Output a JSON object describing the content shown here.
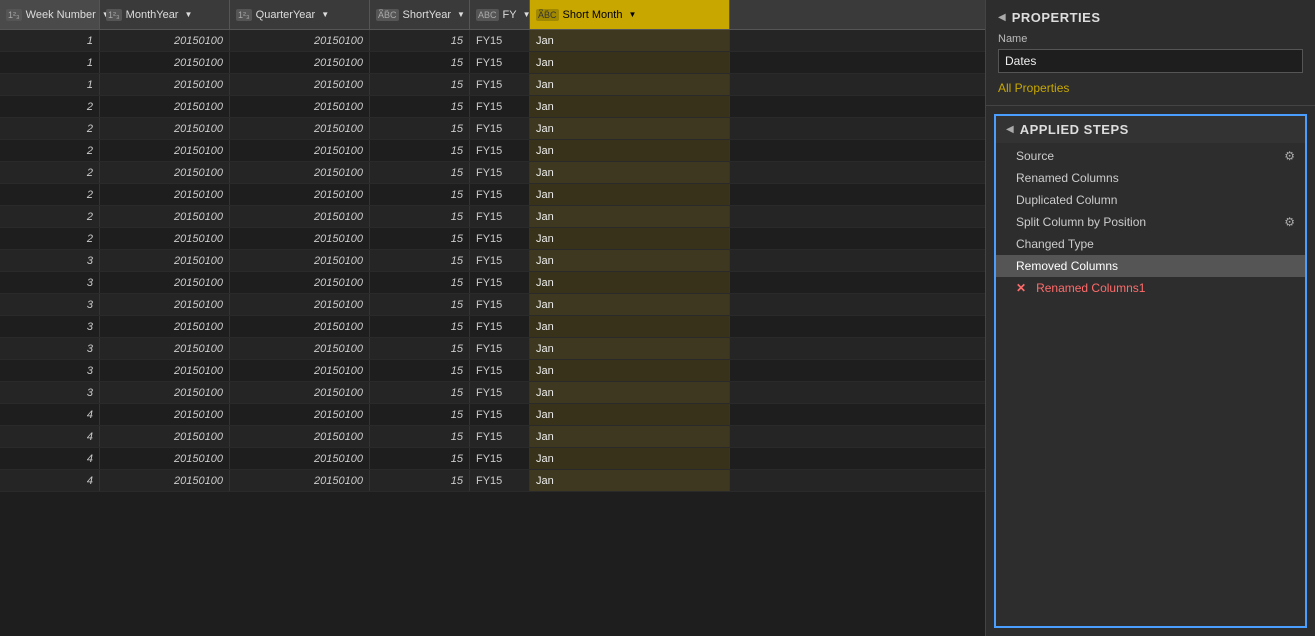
{
  "columns": [
    {
      "id": "week",
      "label": "Week Number",
      "type": "123",
      "typeLabel": "1²₃",
      "active": false
    },
    {
      "id": "month",
      "label": "MonthYear",
      "type": "123",
      "typeLabel": "1²₃",
      "active": false
    },
    {
      "id": "quarter",
      "label": "QuarterYear",
      "type": "123",
      "typeLabel": "1²₃",
      "active": false
    },
    {
      "id": "shortyear",
      "label": "ShortYear",
      "type": "ABC",
      "typeLabel": "A^B_C",
      "active": false
    },
    {
      "id": "fy",
      "label": "FY",
      "type": "ABC",
      "typeLabel": "ABC",
      "active": false
    },
    {
      "id": "shortmonth",
      "label": "Short Month",
      "type": "ABC",
      "typeLabel": "A^B_C",
      "active": true
    }
  ],
  "rows": [
    {
      "week": 1,
      "month": "20150100",
      "quarter": "20150100",
      "short": "15",
      "fy": "FY15",
      "sm": "Jan"
    },
    {
      "week": 1,
      "month": "20150100",
      "quarter": "20150100",
      "short": "15",
      "fy": "FY15",
      "sm": "Jan"
    },
    {
      "week": 1,
      "month": "20150100",
      "quarter": "20150100",
      "short": "15",
      "fy": "FY15",
      "sm": "Jan"
    },
    {
      "week": 2,
      "month": "20150100",
      "quarter": "20150100",
      "short": "15",
      "fy": "FY15",
      "sm": "Jan"
    },
    {
      "week": 2,
      "month": "20150100",
      "quarter": "20150100",
      "short": "15",
      "fy": "FY15",
      "sm": "Jan"
    },
    {
      "week": 2,
      "month": "20150100",
      "quarter": "20150100",
      "short": "15",
      "fy": "FY15",
      "sm": "Jan"
    },
    {
      "week": 2,
      "month": "20150100",
      "quarter": "20150100",
      "short": "15",
      "fy": "FY15",
      "sm": "Jan"
    },
    {
      "week": 2,
      "month": "20150100",
      "quarter": "20150100",
      "short": "15",
      "fy": "FY15",
      "sm": "Jan"
    },
    {
      "week": 2,
      "month": "20150100",
      "quarter": "20150100",
      "short": "15",
      "fy": "FY15",
      "sm": "Jan"
    },
    {
      "week": 2,
      "month": "20150100",
      "quarter": "20150100",
      "short": "15",
      "fy": "FY15",
      "sm": "Jan"
    },
    {
      "week": 3,
      "month": "20150100",
      "quarter": "20150100",
      "short": "15",
      "fy": "FY15",
      "sm": "Jan"
    },
    {
      "week": 3,
      "month": "20150100",
      "quarter": "20150100",
      "short": "15",
      "fy": "FY15",
      "sm": "Jan"
    },
    {
      "week": 3,
      "month": "20150100",
      "quarter": "20150100",
      "short": "15",
      "fy": "FY15",
      "sm": "Jan"
    },
    {
      "week": 3,
      "month": "20150100",
      "quarter": "20150100",
      "short": "15",
      "fy": "FY15",
      "sm": "Jan"
    },
    {
      "week": 3,
      "month": "20150100",
      "quarter": "20150100",
      "short": "15",
      "fy": "FY15",
      "sm": "Jan"
    },
    {
      "week": 3,
      "month": "20150100",
      "quarter": "20150100",
      "short": "15",
      "fy": "FY15",
      "sm": "Jan"
    },
    {
      "week": 3,
      "month": "20150100",
      "quarter": "20150100",
      "short": "15",
      "fy": "FY15",
      "sm": "Jan"
    },
    {
      "week": 4,
      "month": "20150100",
      "quarter": "20150100",
      "short": "15",
      "fy": "FY15",
      "sm": "Jan"
    },
    {
      "week": 4,
      "month": "20150100",
      "quarter": "20150100",
      "short": "15",
      "fy": "FY15",
      "sm": "Jan"
    },
    {
      "week": 4,
      "month": "20150100",
      "quarter": "20150100",
      "short": "15",
      "fy": "FY15",
      "sm": "Jan"
    },
    {
      "week": 4,
      "month": "20150100",
      "quarter": "20150100",
      "short": "15",
      "fy": "FY15",
      "sm": "Jan"
    }
  ],
  "properties": {
    "sectionTitle": "PROPERTIES",
    "nameLabel": "Name",
    "nameValue": "Dates",
    "allPropertiesLabel": "All Properties"
  },
  "appliedSteps": {
    "sectionTitle": "APPLIED STEPS",
    "steps": [
      {
        "id": "source",
        "label": "Source",
        "hasGear": true,
        "hasX": false,
        "selected": false,
        "error": false
      },
      {
        "id": "renamed-cols",
        "label": "Renamed Columns",
        "hasGear": false,
        "hasX": false,
        "selected": false,
        "error": false
      },
      {
        "id": "duplicated-col",
        "label": "Duplicated Column",
        "hasGear": false,
        "hasX": false,
        "selected": false,
        "error": false
      },
      {
        "id": "split-col",
        "label": "Split Column by Position",
        "hasGear": true,
        "hasX": false,
        "selected": false,
        "error": false
      },
      {
        "id": "changed-type",
        "label": "Changed Type",
        "hasGear": false,
        "hasX": false,
        "selected": false,
        "error": false
      },
      {
        "id": "removed-cols",
        "label": "Removed Columns",
        "hasGear": false,
        "hasX": false,
        "selected": true,
        "error": false
      },
      {
        "id": "renamed-cols1",
        "label": "Renamed Columns1",
        "hasGear": false,
        "hasX": true,
        "selected": false,
        "error": true
      }
    ]
  }
}
